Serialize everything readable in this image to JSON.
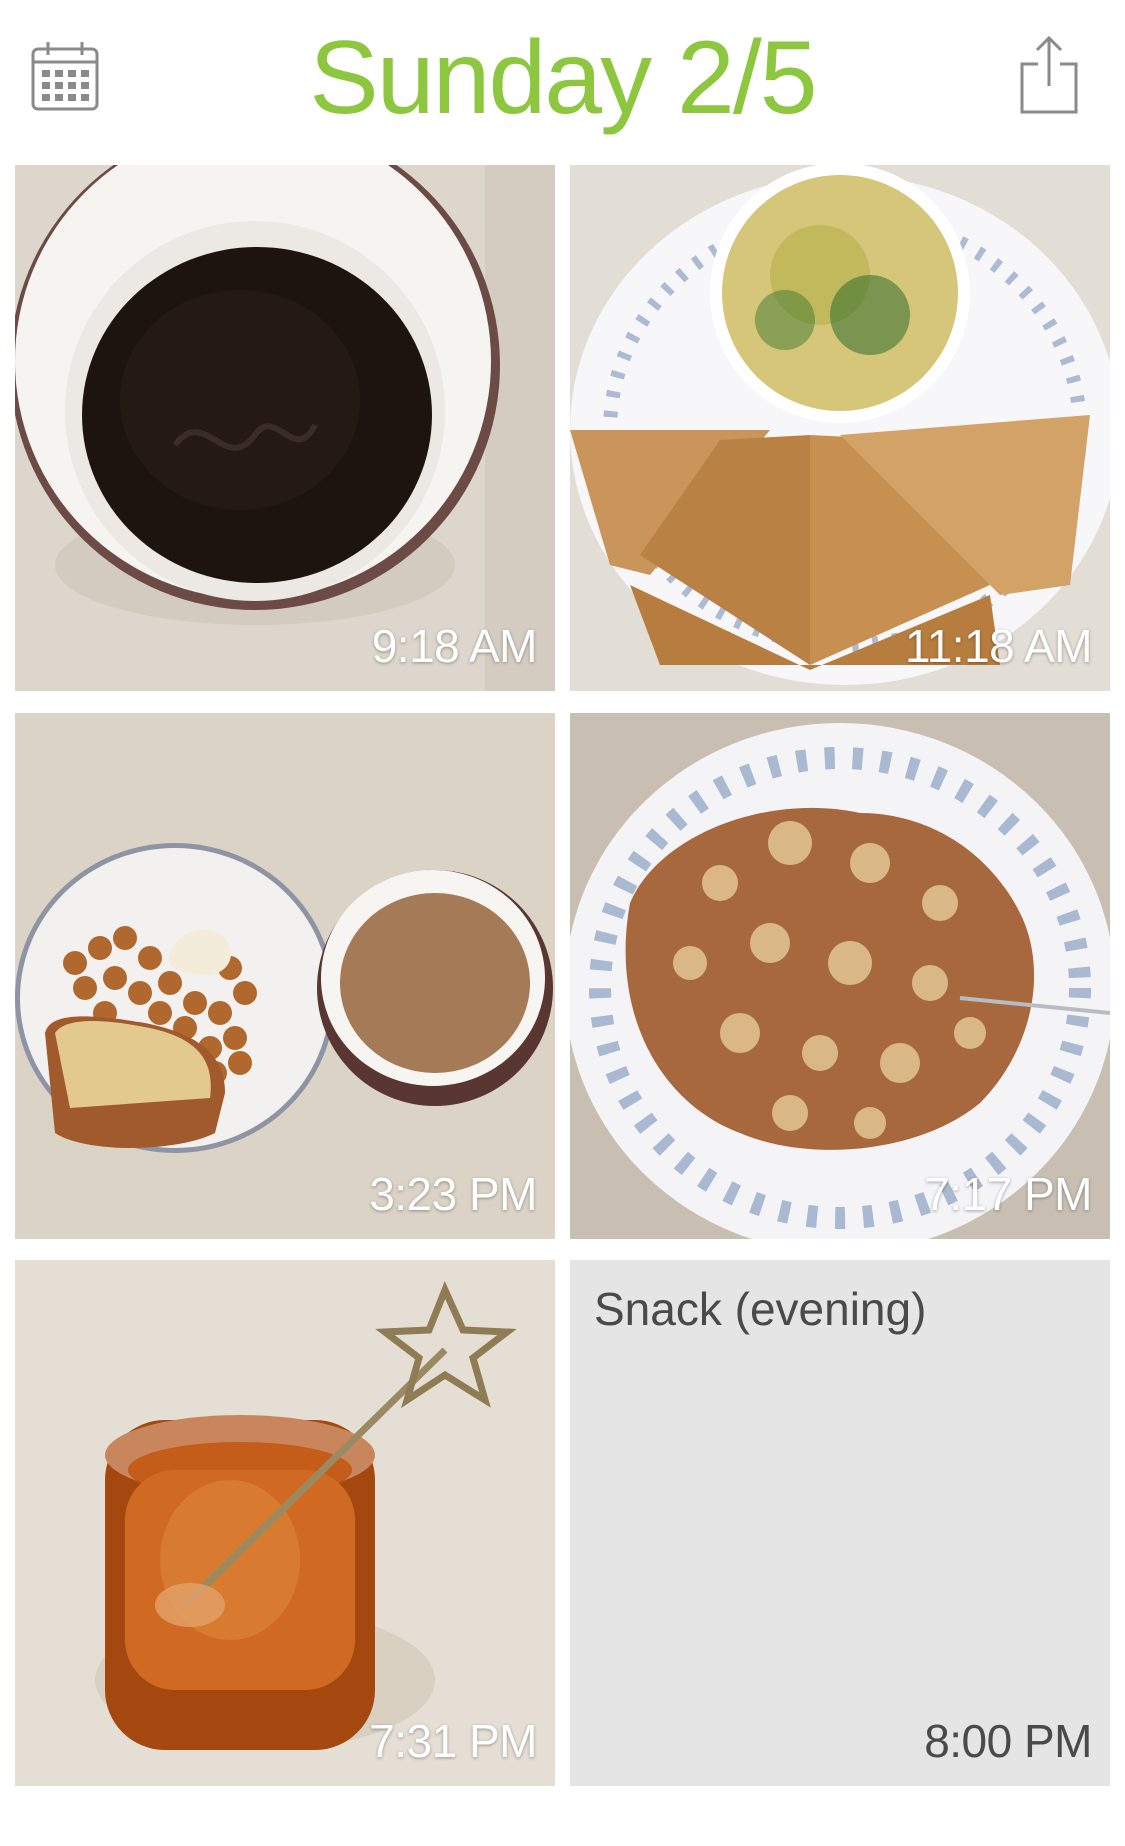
{
  "header": {
    "title": "Sunday 2/5",
    "title_color": "#8dc63f",
    "calendar_icon": "calendar-icon",
    "share_icon": "share-icon"
  },
  "meals": [
    {
      "time": "9:18 AM",
      "photo": "black-coffee-cup"
    },
    {
      "time": "11:18 AM",
      "photo": "quesadilla-with-egg-bowl"
    },
    {
      "time": "3:23 PM",
      "photo": "chickpeas-toast-and-tea"
    },
    {
      "time": "7:17 PM",
      "photo": "cauliflower-stir-fry"
    },
    {
      "time": "7:31 PM",
      "photo": "honey-jar-with-star-spoon"
    },
    {
      "time": "8:00 PM",
      "label": "Snack (evening)"
    }
  ],
  "colors": {
    "icon_gray": "#8a8a8a",
    "empty_tile": "#e5e5e5"
  }
}
